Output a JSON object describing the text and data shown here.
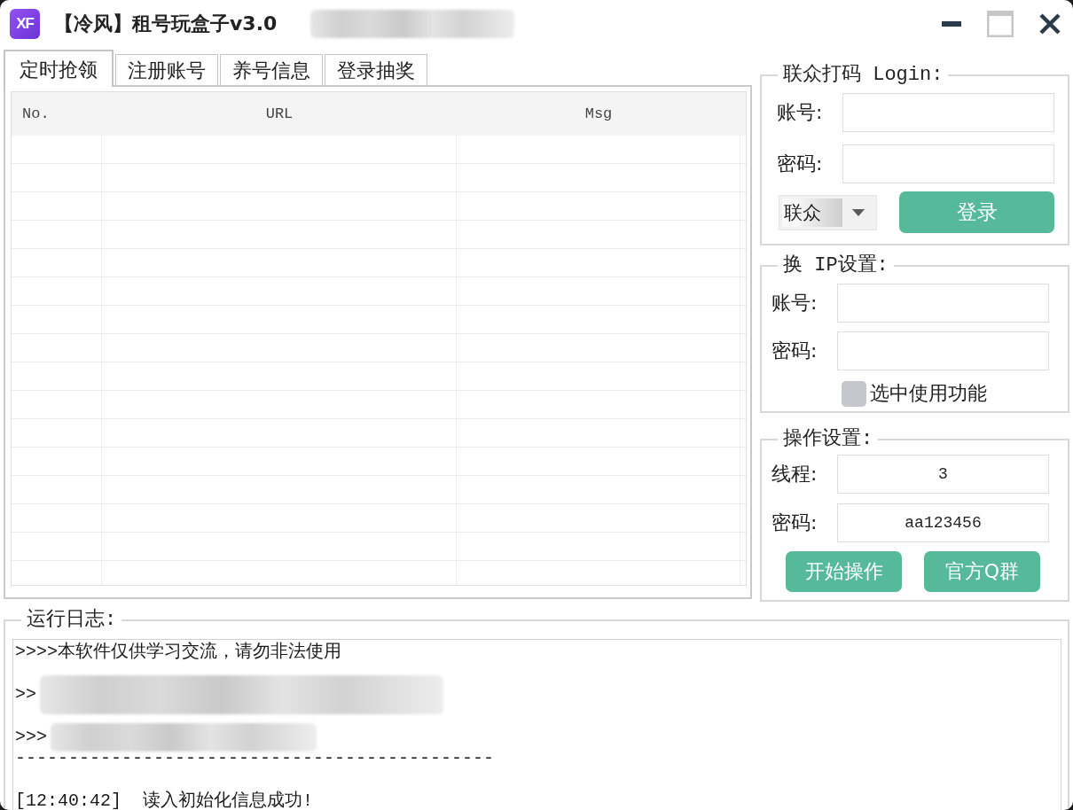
{
  "window": {
    "logo": "XF",
    "title": "【冷风】租号玩盒子v3.0",
    "title_redacted": true
  },
  "tabs": [
    {
      "label": "定时抢领",
      "selected": true
    },
    {
      "label": "注册账号",
      "selected": false
    },
    {
      "label": "养号信息",
      "selected": false
    },
    {
      "label": "登录抽奖",
      "selected": false
    }
  ],
  "table": {
    "columns": [
      "No.",
      "URL",
      "Msg"
    ]
  },
  "login_group": {
    "title": "联众打码 Login:",
    "fields": [
      {
        "label": "账号:"
      },
      {
        "label": "密码:"
      }
    ],
    "platform_select": {
      "value": "联众"
    },
    "button": "登录"
  },
  "ip_group": {
    "title": "换 IP设置:",
    "fields": [
      {
        "label": "账号:"
      },
      {
        "label": "密码:"
      }
    ],
    "checkbox": {
      "label": "选中使用功能",
      "checked": false
    }
  },
  "operation_group": {
    "title": "操作设置:",
    "fields": [
      {
        "label": "线程:",
        "value": "3"
      },
      {
        "label": "密码:",
        "value": "aa123456"
      }
    ],
    "buttons": [
      "开始操作",
      "官方Q群"
    ]
  },
  "log": {
    "title": "运行日志:",
    "lines": [
      {
        "kind": "text",
        "text": ">>>>本软件仅供学习交流，请勿非法使用",
        "redacted": false
      },
      {
        "kind": "text",
        "text": ">>",
        "redacted": true
      },
      {
        "kind": "text",
        "text": ">>>",
        "redacted": true
      },
      {
        "kind": "rule",
        "text": "---------------------------------------------",
        "redacted": false
      },
      {
        "kind": "text",
        "text": "[12:40:42]  读入初始化信息成功!",
        "redacted": false
      }
    ]
  }
}
